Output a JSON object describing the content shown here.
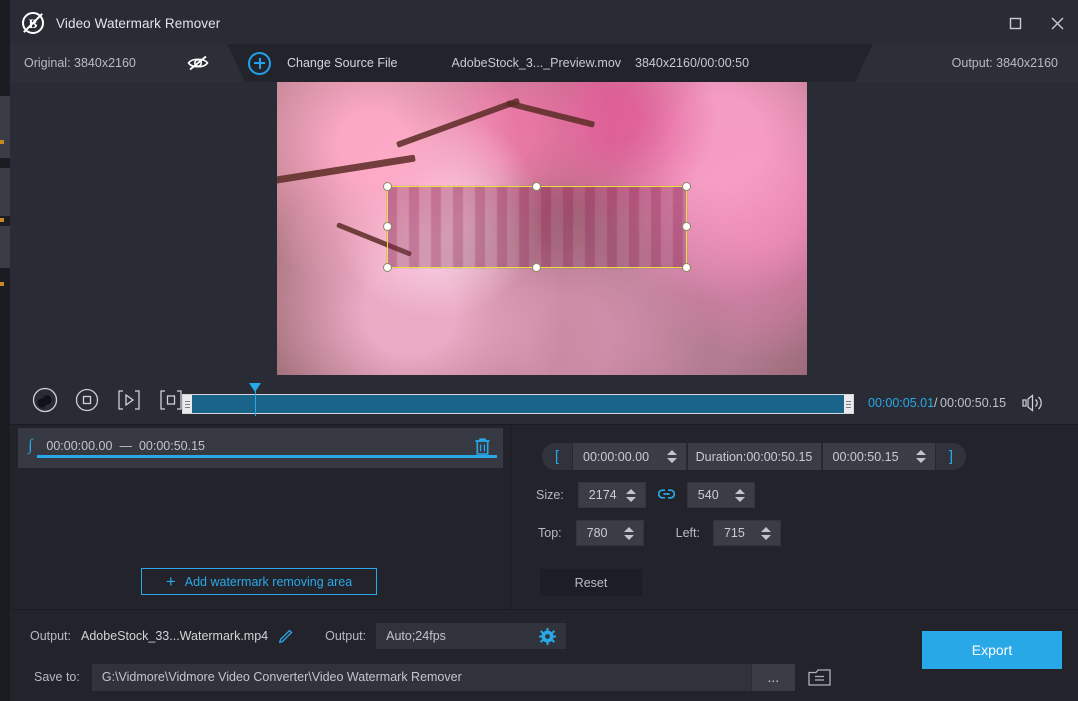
{
  "window": {
    "title": "Video Watermark Remover",
    "logo_icon": "watermark-remover-logo",
    "maximize_icon": "maximize-icon",
    "close_icon": "close-icon"
  },
  "source_bar": {
    "original_label": "Original: 3840x2160",
    "hide_icon": "eye-off-icon",
    "add_icon": "plus-circle-icon",
    "change_source_label": "Change Source File",
    "file_name": "AdobeStock_3..._Preview.mov",
    "file_meta": "3840x2160/00:00:50",
    "output_label": "Output: 3840x2160"
  },
  "preview": {
    "selection_border_color": "#e8e23c",
    "handle_count": 8
  },
  "player": {
    "play_icon": "play-pause-icon",
    "stop_icon": "stop-icon",
    "mark_in_icon": "set-start-icon",
    "mark_out_icon": "set-end-icon",
    "current_time": "00:00:05.01",
    "separator": "/",
    "total_time": "00:00:50.15",
    "volume_icon": "volume-icon",
    "accent_color": "#29a8e8"
  },
  "watermark_list": {
    "item_icon": "watermark-icon",
    "start_time": "00:00:00.00",
    "dash": "—",
    "end_time": "00:00:50.15",
    "delete_icon": "trash-icon",
    "add_button_label": "Add watermark removing area",
    "add_button_icon": "plus-icon"
  },
  "properties": {
    "bracket_open": "[",
    "bracket_close": "]",
    "start_time": "00:00:00.00",
    "duration_label": "Duration:00:00:50.15",
    "end_time": "00:00:50.15",
    "size_label": "Size:",
    "size_width": "2174",
    "size_height": "540",
    "link_icon": "link-icon",
    "top_label": "Top:",
    "top_value": "780",
    "left_label": "Left:",
    "left_value": "715",
    "reset_label": "Reset"
  },
  "bottom": {
    "output_label": "Output:",
    "output_file": "AdobeStock_33...Watermark.mp4",
    "edit_icon": "pencil-icon",
    "format_label": "Output:",
    "format_value": "Auto;24fps",
    "settings_icon": "gear-icon",
    "save_to_label": "Save to:",
    "save_path": "G:\\Vidmore\\Vidmore Video Converter\\Video Watermark Remover",
    "browse_label": "...",
    "open_folder_icon": "folder-icon",
    "export_label": "Export",
    "export_color": "#29a8e8"
  }
}
